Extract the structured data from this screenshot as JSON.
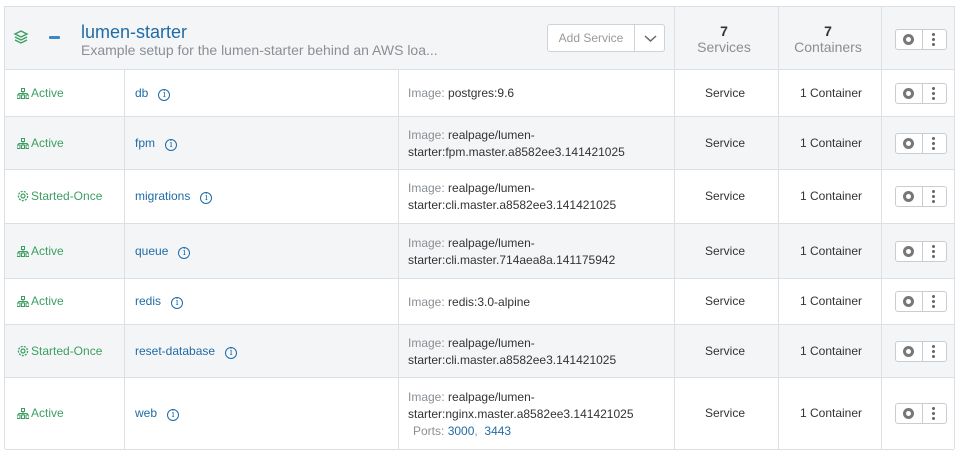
{
  "stack": {
    "name": "lumen-starter",
    "description": "Example setup for the lumen-starter behind an AWS loa...",
    "add_service_label": "Add Service",
    "services_count": "7",
    "services_label": "Services",
    "containers_count": "7",
    "containers_label": "Containers"
  },
  "image_label": "Image:",
  "ports_label": "Ports:",
  "services": [
    {
      "state": "Active",
      "state_icon": "sitemap-icon",
      "name": "db",
      "image": "postgres:9.6",
      "kind": "Service",
      "containers": "1 Container"
    },
    {
      "state": "Active",
      "state_icon": "sitemap-icon",
      "name": "fpm",
      "image": "realpage/lumen-starter:fpm.master.a8582ee3.141421025",
      "kind": "Service",
      "containers": "1 Container"
    },
    {
      "state": "Started-Once",
      "state_icon": "cog-icon",
      "name": "migrations",
      "image": "realpage/lumen-starter:cli.master.a8582ee3.141421025",
      "kind": "Service",
      "containers": "1 Container"
    },
    {
      "state": "Active",
      "state_icon": "sitemap-icon",
      "name": "queue",
      "image": "realpage/lumen-starter:cli.master.714aea8a.141175942",
      "kind": "Service",
      "containers": "1 Container"
    },
    {
      "state": "Active",
      "state_icon": "sitemap-icon",
      "name": "redis",
      "image": "redis:3.0-alpine",
      "kind": "Service",
      "containers": "1 Container"
    },
    {
      "state": "Started-Once",
      "state_icon": "cog-icon",
      "name": "reset-database",
      "image": "realpage/lumen-starter:cli.master.a8582ee3.141421025",
      "kind": "Service",
      "containers": "1 Container"
    },
    {
      "state": "Active",
      "state_icon": "sitemap-icon",
      "name": "web",
      "image": "realpage/lumen-starter:nginx.master.a8582ee3.141421025",
      "kind": "Service",
      "containers": "1 Container",
      "ports": [
        "3000",
        "3443"
      ]
    }
  ],
  "colors": {
    "accent": "#1f6ba6",
    "active": "#3c9f61",
    "muted": "#8a8f94"
  }
}
